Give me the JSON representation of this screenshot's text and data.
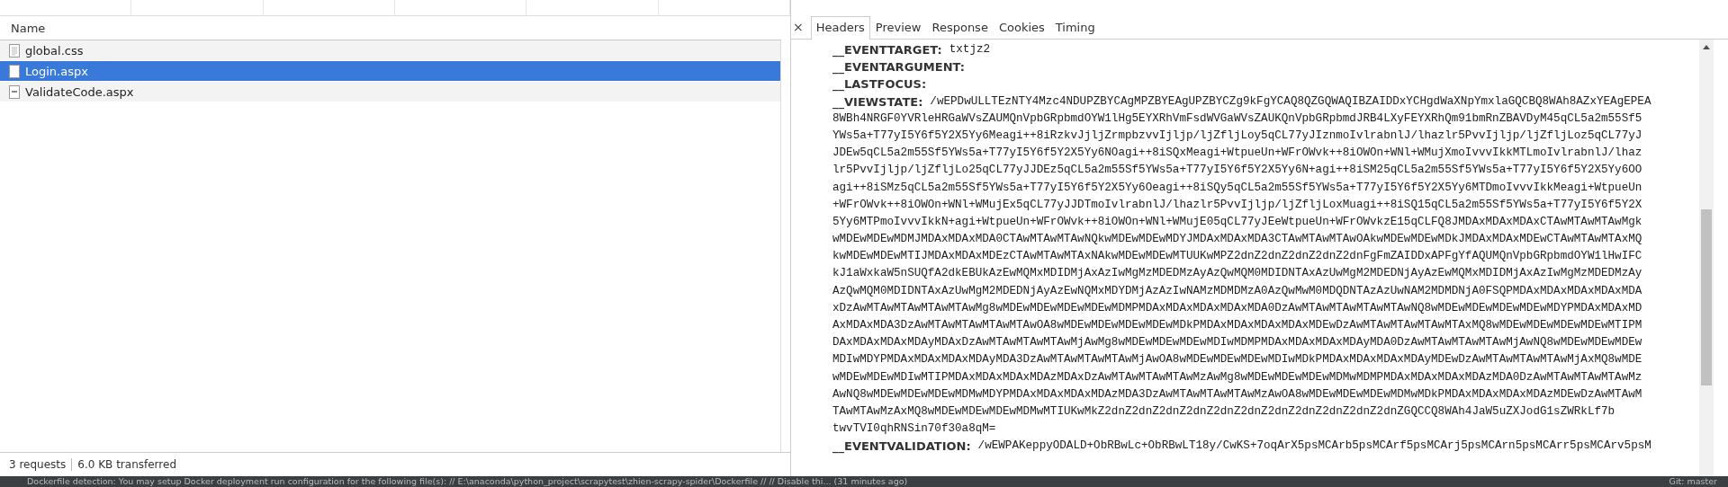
{
  "request_list": {
    "column_header": "Name",
    "rows": [
      {
        "name": "global.css",
        "kind": "stylesheet",
        "selected": false
      },
      {
        "name": "Login.aspx",
        "kind": "document",
        "selected": true
      },
      {
        "name": "ValidateCode.aspx",
        "kind": "image",
        "selected": false
      }
    ]
  },
  "status_bar": {
    "request_count": "3 requests",
    "transferred": "6.0 KB transferred"
  },
  "detail_panel": {
    "close": "×",
    "tabs": [
      {
        "label": "Headers",
        "selected": true
      },
      {
        "label": "Preview",
        "selected": false
      },
      {
        "label": "Response",
        "selected": false
      },
      {
        "label": "Cookies",
        "selected": false
      },
      {
        "label": "Timing",
        "selected": false
      }
    ],
    "form_data": [
      {
        "key": "__EVENTTARGET:",
        "value_lines": [
          "txtjz2"
        ]
      },
      {
        "key": "__EVENTARGUMENT:"
      },
      {
        "key": "__LASTFOCUS:"
      },
      {
        "key": "__VIEWSTATE:",
        "value_lines": [
          "/wEPDwULLTEzNTY4Mzc4NDUPZBYCAgMPZBYEAgUPZBYCZg9kFgYCAQ8QZGQWAQIBZAIDDxYCHgdWaXNpYmxlaGQCBQ8WAh8AZxYEAgEPEA",
          "8WBh4NRGF0YVRleHRGaWVsZAUMQnVpbGRpbmdOYW1lHg5EYXRhVmFsdWVGaWVsZAUKQnVpbGRpbmdJRB4LXyFEYXRhQm91bmRnZBAVDyM45qCL5a2m55Sf5",
          "YWs5a+T77yI5Y6f5Y2X5Yy6Meagi++8iRzkvJjljZrmpbzvvIjljp/ljZfljLoy5qCL77yJIznmoIvlrabnlJ/lhazlr5PvvIjljp/ljZfljLoz5qCL77yJ",
          "JDEw5qCL5a2m55Sf5YWs5a+T77yI5Y6f5Y2X5Yy6NOagi++8iSQxMeagi+WtpueUn+WFrOWvk++8iOWOn+WNl+WMujXmoIvvvIkkMTLmoIvlrabnlJ/lhaz",
          "lr5PvvIjljp/ljZfljLo25qCL77yJJDEz5qCL5a2m55Sf5YWs5a+T77yI5Y6f5Y2X5Yy6N+agi++8iSM25qCL5a2m55Sf5YWs5a+T77yI5Y6f5Y2X5Yy6OO",
          "agi++8iSMz5qCL5a2m55Sf5YWs5a+T77yI5Y6f5Y2X5Yy6Oeagi++8iSQy5qCL5a2m55Sf5YWs5a+T77yI5Y6f5Y2X5Yy6MTDmoIvvvIkkMeagi+WtpueUn",
          "+WFrOWvk++8iOWOn+WNl+WMujEx5qCL77yJJDTmoIvlrabnlJ/lhazlr5PvvIjljp/ljZfljLoxMuagi++8iSQ15qCL5a2m55Sf5YWs5a+T77yI5Y6f5Y2X",
          "5Yy6MTPmoIvvvIkkN+agi+WtpueUn+WFrOWvk++8iOWOn+WNl+WMujE05qCL77yJEeWtpueUn+WFrOWvkzE15qCLFQ8JMDAxMDAxMDAxCTAwMTAwMTAwMgk",
          "wMDEwMDEwMDMJMDAxMDAxMDA0CTAwMTAwMTAwNQkwMDEwMDEwMDYJMDAxMDAxMDA3CTAwMTAwMTAwOAkwMDEwMDEwMDkJMDAxMDAxMDEwCTAwMTAwMTAxMQ",
          "kwMDEwMDEwMTIJMDAxMDAxMDEzCTAwMTAwMTAxNAkwMDEwMDEwMTUUKwMPZ2dnZ2dnZ2dnZ2dnZ2dnFgFmZAIDDxAPFgYfAQUMQnVpbGRpbmdOYW1lHwIFC",
          "kJ1aWxkaW5nSUQfA2dkEBUkAzEwMQMxMDIDMjAxAzIwMgMzMDEDMzAyAzQwMQM0MDIDNTAxAzUwMgM2MDEDNjAyAzEwMQMxMDIDMjAxAzIwMgMzMDEDMzAy",
          "AzQwMQM0MDIDNTAxAzUwMgM2MDEDNjAyAzEwNQMxMDYDMjAzAzIwNAMzMDMDMzA0AzQwMwM0MDQDNTAzAzUwNAM2MDMDNjA0FSQPMDAxMDAxMDAxMDAxMDA",
          "xDzAwMTAwMTAwMTAwMTAwMg8wMDEwMDEwMDEwMDEwMDMPMDAxMDAxMDAxMDAxMDA0DzAwMTAwMTAwMTAwMTAwNQ8wMDEwMDEwMDEwMDEwMDYPMDAxMDAxMD",
          "AxMDAxMDA3DzAwMTAwMTAwMTAwMTAwOA8wMDEwMDEwMDEwMDEwMDkPMDAxMDAxMDAxMDAxMDEwDzAwMTAwMTAwMTAwMTAxMQ8wMDEwMDEwMDEwMDEwMTIPM",
          "DAxMDAxMDAxMDAyMDAxDzAwMTAwMTAwMTAwMjAwMg8wMDEwMDEwMDEwMDIwMDMPMDAxMDAxMDAxMDAyMDA0DzAwMTAwMTAwMTAwMjAwNQ8wMDEwMDEwMDEw",
          "MDIwMDYPMDAxMDAxMDAxMDAyMDA3DzAwMTAwMTAwMTAwMjAwOA8wMDEwMDEwMDEwMDIwMDkPMDAxMDAxMDAxMDAyMDEwDzAwMTAwMTAwMTAwMjAxMQ8wMDE",
          "wMDEwMDEwMDIwMTIPMDAxMDAxMDAxMDAzMDAxDzAwMTAwMTAwMTAwMzAwMg8wMDEwMDEwMDEwMDMwMDMPMDAxMDAxMDAxMDAzMDA0DzAwMTAwMTAwMTAwMz",
          "AwNQ8wMDEwMDEwMDEwMDMwMDYPMDAxMDAxMDAxMDAzMDA3DzAwMTAwMTAwMTAwMzAwOA8wMDEwMDEwMDEwMDMwMDkPMDAxMDAxMDAxMDAzMDEwDzAwMTAwM",
          "TAwMTAwMzAxMQ8wMDEwMDEwMDEwMDMwMTIUKwMkZ2dnZ2dnZ2dnZ2dnZ2dnZ2dnZ2dnZ2dnZ2dnZ2dnZ2dnZGQCCQ8WAh4JaW5uZXJodG1sZWRkLf7b",
          "twvTVI0qhRNSin70f30a8qM="
        ]
      },
      {
        "key": "__EVENTVALIDATION:",
        "value_lines": [
          "/wEWPAKeppyODALD+ObRBwLc+ObRBwLT18y/CwKS+7oqArX5psMCArb5psMCArf5psMCArj5psMCArn5psMCArr5psMCArv5psM"
        ]
      }
    ]
  },
  "ide_status_bar": {
    "message": "Dockerfile detection: You may setup Docker deployment run configuration for the following file(s): // E:\\anaconda\\python_project\\scrapytest\\zhien-scrapy-spider\\Dockerfile // // Disable thi... (31 minutes ago)",
    "branch": "Git: master"
  }
}
